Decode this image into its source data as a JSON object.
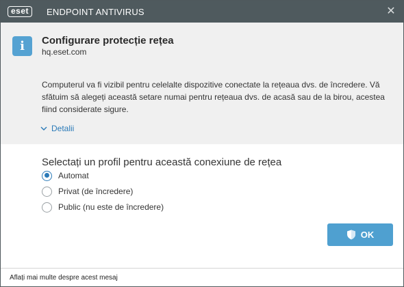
{
  "titlebar": {
    "logo_text": "eset",
    "app_title": "ENDPOINT ANTIVIRUS",
    "close_glyph": "✕"
  },
  "info": {
    "icon_glyph": "i",
    "title": "Configurare protecție rețea",
    "subtitle": "hq.eset.com",
    "description": "Computerul va fi vizibil pentru celelalte dispozitive conectate la rețeaua dvs. de încredere. Vă sfătuim să alegeți această setare numai pentru rețeaua dvs. de acasă sau de la birou, acestea fiind considerate sigure.",
    "details_label": "Detalii"
  },
  "profile": {
    "heading": "Selectați un profil pentru această conexiune de rețea",
    "options": [
      {
        "label": "Automat",
        "selected": true
      },
      {
        "label": "Privat (de încredere)",
        "selected": false
      },
      {
        "label": "Public (nu este de încredere)",
        "selected": false
      }
    ]
  },
  "actions": {
    "ok_label": "OK"
  },
  "footer": {
    "link": "Aflați mai multe despre acest mesaj"
  },
  "colors": {
    "titlebar": "#4f5a5e",
    "accent": "#2a7ab8",
    "button": "#4fa0d0",
    "info_icon": "#55a2d2",
    "panel": "#f0f0f0"
  },
  "icons": {
    "logo": "eset-logo-icon",
    "close": "close-icon",
    "info": "info-icon",
    "details": "chevron-down-icon",
    "ok": "shield-icon"
  }
}
